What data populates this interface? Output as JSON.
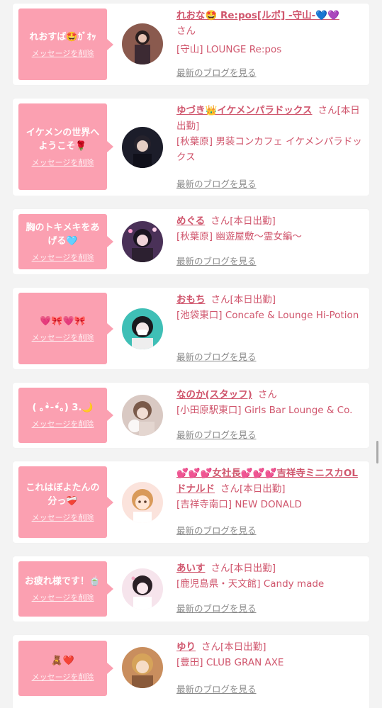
{
  "entries": [
    {
      "bubble_text": "れおすば🤩ｶﾞｵｯ",
      "delete_label": "メッセージを削除",
      "name": "れおな🤩 Re:pos[ルポ] -守山-💙💜",
      "status": "さん",
      "shop": "[守山] LOUNGE Re:pos",
      "blog": "最新のブログを見る"
    },
    {
      "bubble_text": "イケメンの世界へ\nようこそ🌹",
      "delete_label": "メッセージを削除",
      "name": "ゆづき👑イケメンパラドックス",
      "status": "さん[本日出勤]",
      "shop": "[秋葉原] 男装コンカフェ イケメンパラドックス",
      "blog": "最新のブログを見る"
    },
    {
      "bubble_text": "胸のトキメキをあ\nげる🩵",
      "delete_label": "メッセージを削除",
      "name": "めぐる",
      "status": "さん[本日出勤]",
      "shop": "[秋葉原] 幽遊屋敷〜霊女編〜",
      "blog": "最新のブログを見る"
    },
    {
      "bubble_text": "💗🎀💗🎀",
      "delete_label": "メッセージを削除",
      "name": "おもち",
      "status": "さん[本日出勤]",
      "shop": "[池袋東口] Concafe & Lounge Hi-Potion",
      "blog": "最新のブログを見る"
    },
    {
      "bubble_text": "( ｡•̀-•́｡) 3.🌙",
      "delete_label": "メッセージを削除",
      "name": "なのか(スタッフ)",
      "status": "さん",
      "shop": "[小田原駅東口] Girls Bar Lounge & Co.",
      "blog": "最新のブログを見る"
    },
    {
      "bubble_text": "これはぼよたんの\n分っ❤️‍🩹",
      "delete_label": "メッセージを削除",
      "name": "💕💕💕女社長💕💕💕吉祥寺ミニスカOLドナルド",
      "status": "さん[本日出勤]",
      "shop": "[吉祥寺南口] NEW DONALD",
      "blog": "最新のブログを見る"
    },
    {
      "bubble_text": "お疲れ様です！🍵",
      "delete_label": "メッセージを削除",
      "name": "あいす",
      "status": "さん[本日出勤]",
      "shop": "[鹿児島県・天文館] Candy made",
      "blog": "最新のブログを見る"
    },
    {
      "bubble_text": "🧸❤️",
      "delete_label": "メッセージを削除",
      "name": "ゆり",
      "status": "さん[本日出勤]",
      "shop": "[豊田] CLUB GRAN AXE",
      "blog": "最新のブログを見る"
    }
  ],
  "colors": {
    "bubble": "#fba0b1",
    "accent": "#d0566d",
    "muted": "#8a8a8a"
  }
}
